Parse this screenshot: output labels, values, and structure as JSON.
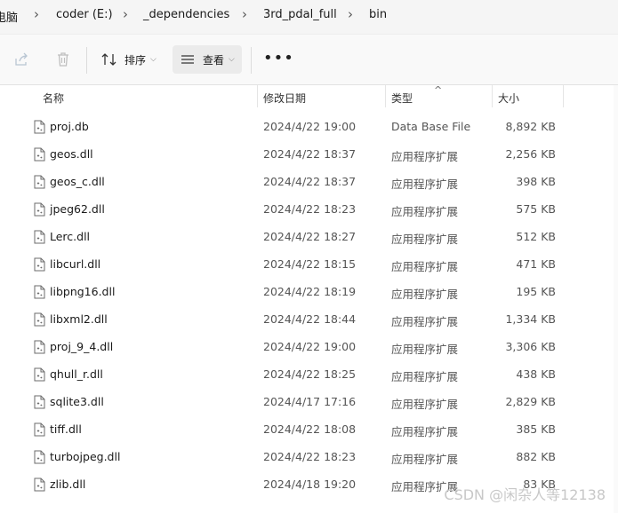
{
  "breadcrumb": {
    "items": [
      "电脑",
      "coder (E:)",
      "_dependencies",
      "3rd_pdal_full",
      "bin"
    ]
  },
  "toolbar": {
    "share_icon": "share-icon",
    "delete_icon": "trash-icon",
    "sort_label": "排序",
    "view_label": "查看",
    "more_label": "•••"
  },
  "columns": {
    "name": "名称",
    "date": "修改日期",
    "type": "类型",
    "size": "大小"
  },
  "files": [
    {
      "name": "proj.db",
      "date": "2024/4/22 19:00",
      "type": "Data Base File",
      "size": "8,892 KB"
    },
    {
      "name": "geos.dll",
      "date": "2024/4/22 18:37",
      "type": "应用程序扩展",
      "size": "2,256 KB"
    },
    {
      "name": "geos_c.dll",
      "date": "2024/4/22 18:37",
      "type": "应用程序扩展",
      "size": "398 KB"
    },
    {
      "name": "jpeg62.dll",
      "date": "2024/4/22 18:23",
      "type": "应用程序扩展",
      "size": "575 KB"
    },
    {
      "name": "Lerc.dll",
      "date": "2024/4/22 18:27",
      "type": "应用程序扩展",
      "size": "512 KB"
    },
    {
      "name": "libcurl.dll",
      "date": "2024/4/22 18:15",
      "type": "应用程序扩展",
      "size": "471 KB"
    },
    {
      "name": "libpng16.dll",
      "date": "2024/4/22 18:19",
      "type": "应用程序扩展",
      "size": "195 KB"
    },
    {
      "name": "libxml2.dll",
      "date": "2024/4/22 18:44",
      "type": "应用程序扩展",
      "size": "1,334 KB"
    },
    {
      "name": "proj_9_4.dll",
      "date": "2024/4/22 19:00",
      "type": "应用程序扩展",
      "size": "3,306 KB"
    },
    {
      "name": "qhull_r.dll",
      "date": "2024/4/22 18:25",
      "type": "应用程序扩展",
      "size": "438 KB"
    },
    {
      "name": "sqlite3.dll",
      "date": "2024/4/17 17:16",
      "type": "应用程序扩展",
      "size": "2,829 KB"
    },
    {
      "name": "tiff.dll",
      "date": "2024/4/22 18:08",
      "type": "应用程序扩展",
      "size": "385 KB"
    },
    {
      "name": "turbojpeg.dll",
      "date": "2024/4/22 18:23",
      "type": "应用程序扩展",
      "size": "882 KB"
    },
    {
      "name": "zlib.dll",
      "date": "2024/4/18 19:20",
      "type": "应用程序扩展",
      "size": "83 KB"
    }
  ],
  "watermark": "CSDN @闲杂人等12138"
}
